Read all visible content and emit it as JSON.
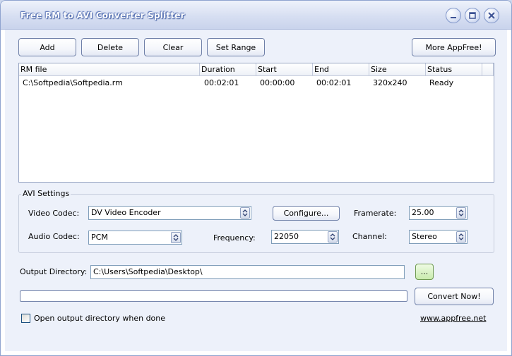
{
  "window": {
    "title": "Free RM to AVI Converter Splitter"
  },
  "toolbar": {
    "add_label": "Add",
    "delete_label": "Delete",
    "clear_label": "Clear",
    "set_range_label": "Set Range",
    "more_label": "More AppFree!"
  },
  "list": {
    "columns": [
      "RM file",
      "Duration",
      "Start",
      "End",
      "Size",
      "Status"
    ],
    "rows": [
      {
        "file": "C:\\Softpedia\\Softpedia.rm",
        "duration": "00:02:01",
        "start": "00:00:00",
        "end": "00:02:01",
        "size": "320x240",
        "status": "Ready"
      }
    ]
  },
  "avi": {
    "group_label": "AVI Settings",
    "video_codec_label": "Video Codec:",
    "video_codec_value": "DV Video Encoder",
    "configure_label": "Configure...",
    "framerate_label": "Framerate:",
    "framerate_value": "25.00",
    "audio_codec_label": "Audio Codec:",
    "audio_codec_value": "PCM",
    "frequency_label": "Frequency:",
    "frequency_value": "22050",
    "channel_label": "Channel:",
    "channel_value": "Stereo"
  },
  "output": {
    "label": "Output Directory:",
    "value": "C:\\Users\\Softpedia\\Desktop\\",
    "browse_label": "...",
    "convert_label": "Convert Now!",
    "progress": 0,
    "open_when_done_label": "Open output directory when done",
    "open_when_done_checked": false,
    "link_text": "www.appfree.net"
  },
  "colors": {
    "title_text": "#ffffff",
    "window_bg": "#edf1fa",
    "browse_button": "#d9f2c2"
  }
}
